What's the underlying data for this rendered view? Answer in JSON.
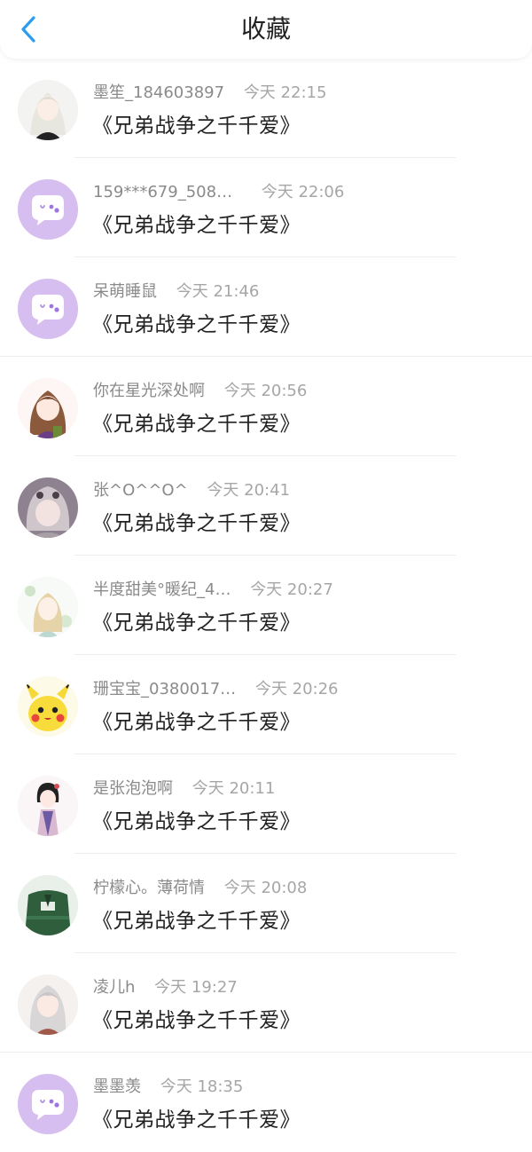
{
  "header": {
    "title": "收藏",
    "back_icon": "chevron-left-icon"
  },
  "colors": {
    "accent": "#2c9cf0",
    "default_avatar": "#d6bff0"
  },
  "items": [
    {
      "name": "墨笙_184603897",
      "time": "今天 22:15",
      "work": "《兄弟战争之千千爱》",
      "avatar": "white-hair-girl"
    },
    {
      "name": "159***679_5089…",
      "time": "今天 22:06",
      "work": "《兄弟战争之千千爱》",
      "avatar": "default-chat-bubble"
    },
    {
      "name": "呆萌睡鼠",
      "time": "今天 21:46",
      "work": "《兄弟战争之千千爱》",
      "avatar": "default-chat-bubble"
    },
    {
      "name": "你在星光深处啊",
      "time": "今天 20:56",
      "work": "《兄弟战争之千千爱》",
      "avatar": "brown-hair-girl"
    },
    {
      "name": "张^O^^O^",
      "time": "今天 20:41",
      "work": "《兄弟战争之千千爱》",
      "avatar": "hooded-girl"
    },
    {
      "name": "半度甜美°暖纪_4…",
      "time": "今天 20:27",
      "work": "《兄弟战争之千千爱》",
      "avatar": "flower-girl"
    },
    {
      "name": "珊宝宝_0380017…",
      "time": "今天 20:26",
      "work": "《兄弟战争之千千爱》",
      "avatar": "pikachu"
    },
    {
      "name": "是张泡泡啊",
      "time": "今天 20:11",
      "work": "《兄弟战争之千千爱》",
      "avatar": "hanfu-girl"
    },
    {
      "name": "柠檬心。薄荷情",
      "time": "今天 20:08",
      "work": "《兄弟战争之千千爱》",
      "avatar": "green-jacket"
    },
    {
      "name": "凌儿h",
      "time": "今天 19:27",
      "work": "《兄弟战争之千千爱》",
      "avatar": "silver-hair-girl"
    },
    {
      "name": "墨墨羡",
      "time": "今天 18:35",
      "work": "《兄弟战争之千千爱》",
      "avatar": "default-chat-bubble"
    }
  ]
}
